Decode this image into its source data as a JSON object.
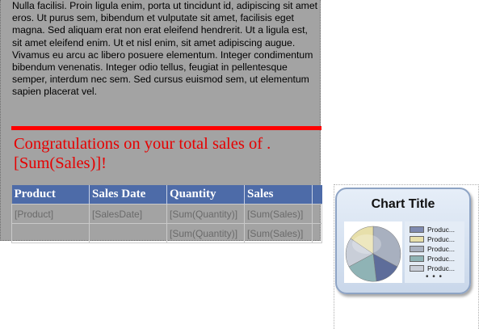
{
  "report": {
    "body_text": "Nulla facilisi. Proin ligula enim, porta ut tincidunt id, adipiscing sit amet eros. Ut purus sem, bibendum et vulputate sit amet, facilisis eget magna. Sed aliquam erat non erat eleifend hendrerit. Ut a ligula est, sit amet eleifend enim. Ut et nisl enim, sit amet adipiscing augue. Vivamus eu arcu ac libero posuere elementum. Integer condimentum bibendum venenatis. Integer odio tellus, feugiat in pellentesque semper, interdum nec sem. Sed cursus euismod sem, ut elementum sapien placerat vel.",
    "congrats": "Congratulations on your total sales of .[Sum(Sales)]!",
    "table": {
      "headers": [
        "Product",
        "Sales Date",
        "Quantity",
        "Sales"
      ],
      "rows": [
        [
          "[Product]",
          "[SalesDate]",
          "[Sum(Quantity)]",
          "[Sum(Sales)]"
        ],
        [
          "",
          "",
          "[Sum(Quantity)]",
          "[Sum(Sales)]"
        ]
      ]
    }
  },
  "chart": {
    "title": "Chart Title",
    "legend": [
      "Produc...",
      "Produc...",
      "Produc...",
      "Produc...",
      "Produc..."
    ],
    "legend_more": "• • •",
    "slice_colors": [
      "#5e6d9a",
      "#e7dfaa",
      "#a8b0bf",
      "#8fb3b5",
      "#c9ced8"
    ],
    "accent": "#ff0000",
    "header_color": "#4d6ba8"
  }
}
